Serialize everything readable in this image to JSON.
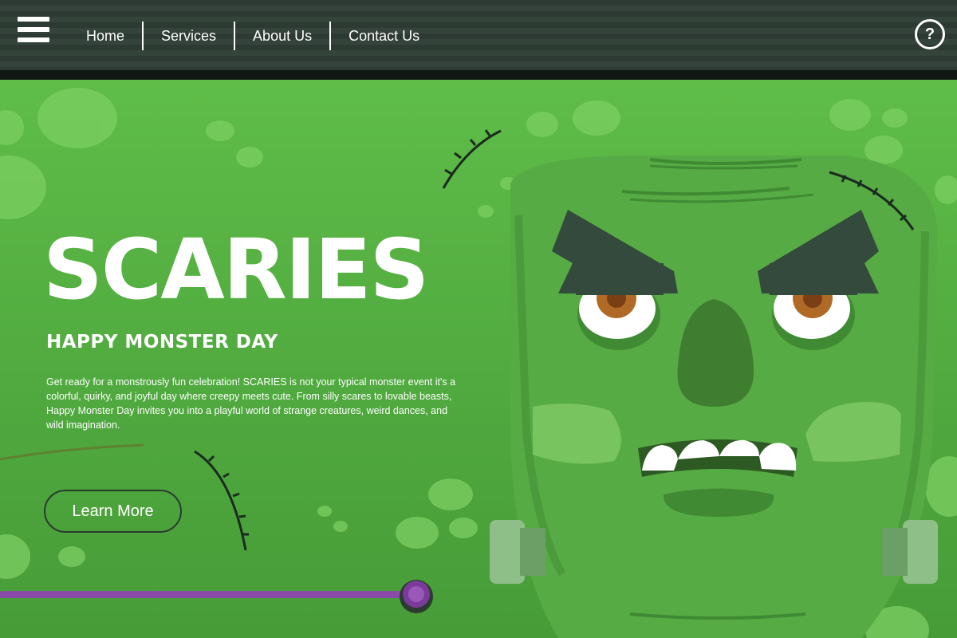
{
  "nav": {
    "menu_icon": "hamburger-menu-icon",
    "links": [
      "Home",
      "Services",
      "About Us",
      "Contact Us"
    ],
    "help_icon": "?"
  },
  "hero": {
    "title": "SCARIES",
    "subtitle": "HAPPY MONSTER DAY",
    "description": "Get ready for a monstrously fun celebration! SCARIES is not your typical monster event it's a colorful, quirky, and joyful day where creepy meets cute. From silly scares to lovable beasts, Happy Monster Day invites you into a playful world of strange creatures, weird dances, and wild imagination.",
    "cta_label": "Learn More"
  },
  "colors": {
    "nav_bg": "#2c3a33",
    "hero_bg": "#5fbd48",
    "monster_skin": "#4e9c3e",
    "brow": "#344a3c",
    "slider_track": "#8a4aa8",
    "slider_knob": "#7b3b9b"
  }
}
